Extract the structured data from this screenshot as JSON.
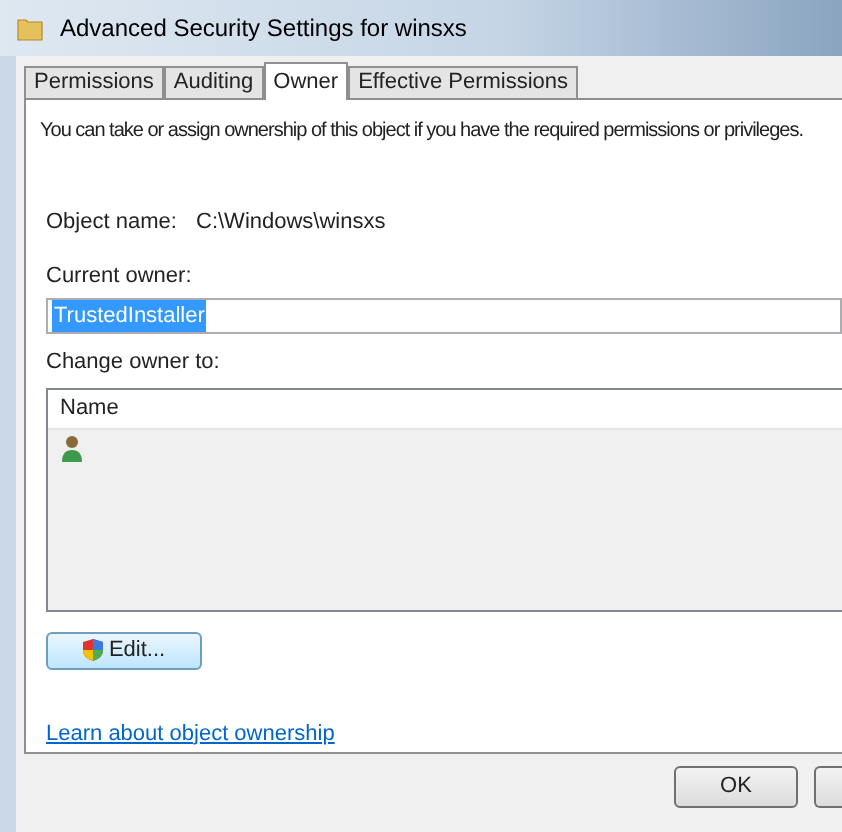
{
  "window": {
    "title": "Advanced Security Settings for winsxs"
  },
  "tabs": [
    {
      "label": "Permissions",
      "selected": false
    },
    {
      "label": "Auditing",
      "selected": false
    },
    {
      "label": "Owner",
      "selected": true
    },
    {
      "label": "Effective Permissions",
      "selected": false
    }
  ],
  "intro": "You can take or assign ownership of this object if you have the required permissions or privileges.",
  "object_name": {
    "label": "Object name:",
    "value": "C:\\Windows\\winsxs"
  },
  "current_owner": {
    "label": "Current owner:",
    "value": "TrustedInstaller"
  },
  "change_owner": {
    "label": "Change owner to:",
    "columns": [
      "Name"
    ],
    "rows": [
      {
        "kind": "user"
      }
    ]
  },
  "edit_button": "Edit...",
  "link": "Learn about object ownership",
  "buttons": [
    "OK"
  ]
}
